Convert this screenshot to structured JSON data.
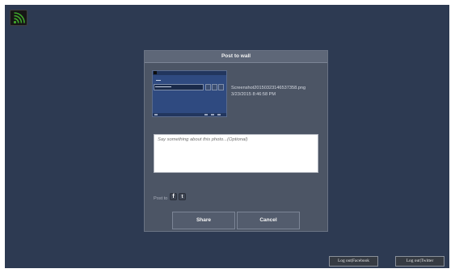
{
  "app": {
    "icon": "wifi-signal-icon",
    "accent_color": "#3fa62c"
  },
  "dialog": {
    "title": "Post to wall",
    "file_name": "Screenshot20150323146537358.png",
    "file_date": "3/23/2015 8:46:58 PM",
    "message_placeholder": "Say something about this photo...(Optional)",
    "post_to_label": "Post to",
    "facebook_glyph": "f",
    "twitter_glyph": "t",
    "share_label": "Share",
    "cancel_label": "Cancel"
  },
  "footer": {
    "logout_facebook_label": "Log out|Facebook",
    "logout_twitter_label": "Log out|Twitter"
  },
  "colors": {
    "background": "#2d3a52",
    "dialog": "#4c5565",
    "button": "#535c6d"
  }
}
